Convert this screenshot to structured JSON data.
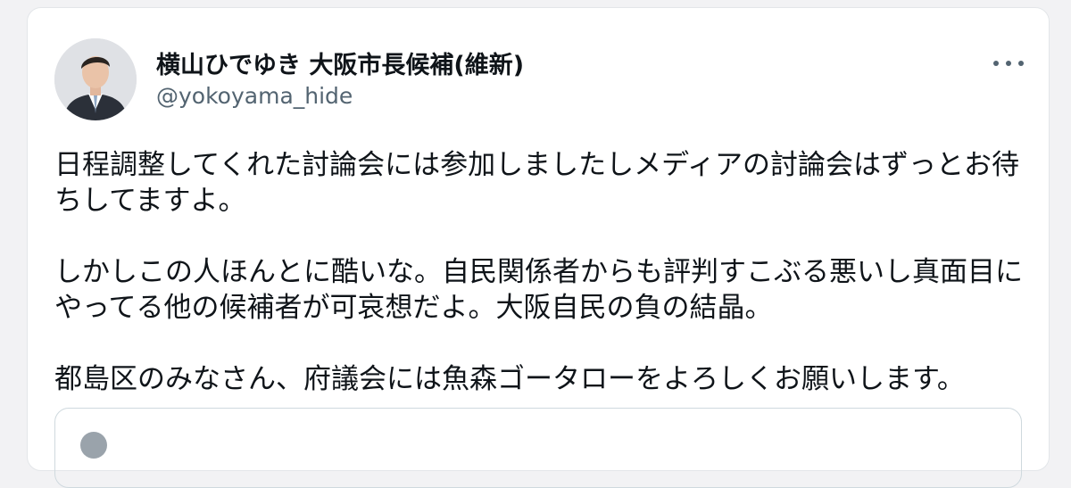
{
  "tweet": {
    "author": {
      "display_name": "横山ひでゆき 大阪市長候補(維新)",
      "handle": "@yokoyama_hide",
      "avatar_icon": "profile-photo"
    },
    "more_icon": "more-horizontal-icon",
    "paragraphs": [
      "日程調整してくれた討論会には参加しましたしメディアの討論会はずっとお待\nちしてますよ。",
      "しかしこの人ほんとに酷いな。自民関係者からも評判すこぶる悪いし真面目に\nやってる他の候補者が可哀想だよ。大阪自民の負の結晶。",
      "都島区のみなさん、府議会には魚森ゴータローをよろしくお願いします。"
    ]
  },
  "colors": {
    "text_primary": "#0f1419",
    "text_secondary": "#536471",
    "border": "#cfd9de",
    "background": "#ffffff"
  }
}
